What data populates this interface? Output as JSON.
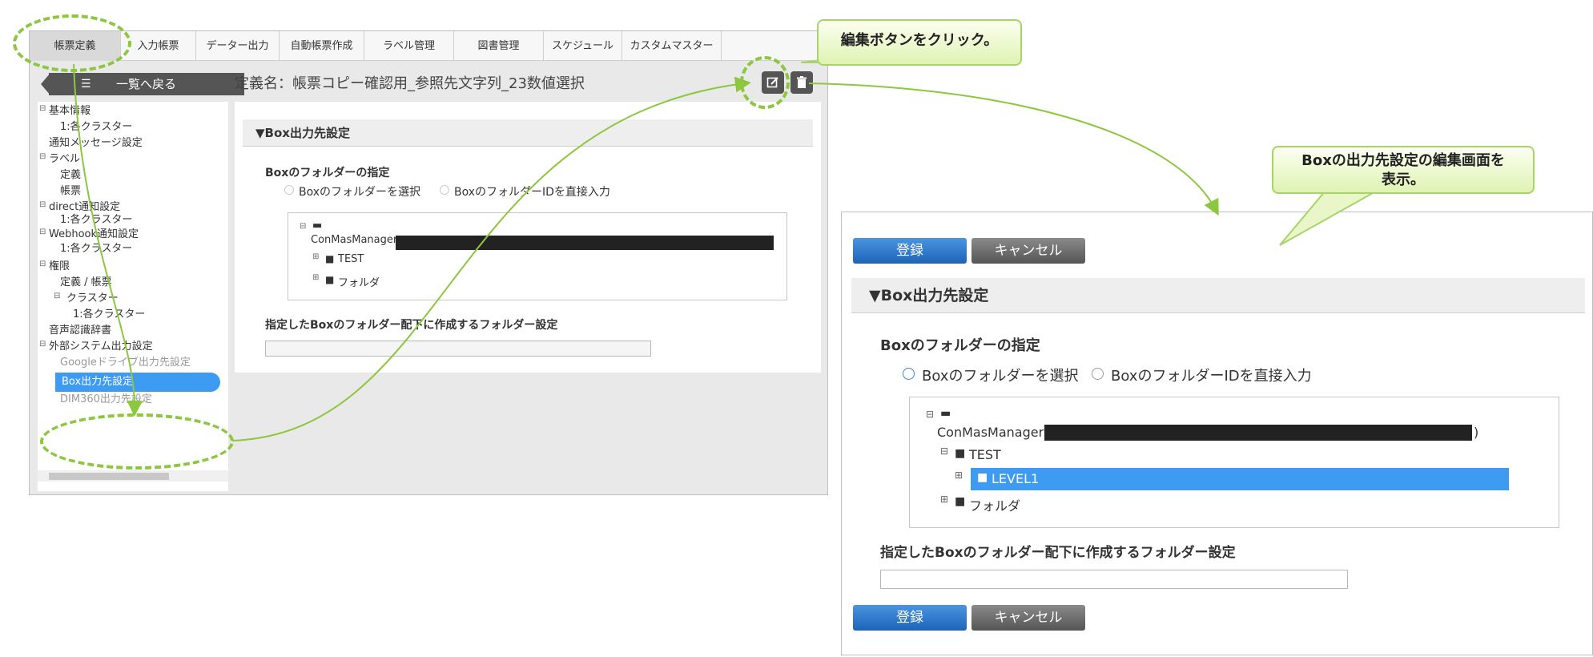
{
  "left_screen": {
    "tabs": [
      "帳票定義",
      "入力帳票",
      "データー出力",
      "自動帳票作成",
      "ラベル管理",
      "図書管理",
      "スケジュール",
      "カスタムマスター"
    ],
    "back_button": "一覧へ戻る",
    "definition_title": "定義名：帳票コピー確認用_参照先文字列_23数値選択",
    "tree": {
      "basic_info": "基本情報",
      "basic_cluster": "1:各クラスター",
      "notification_msg": "通知メッセージ設定",
      "label": "ラベル",
      "label_definition": "定義",
      "label_form": "帳票",
      "direct_notify": "direct通知設定",
      "direct_cluster": "1:各クラスター",
      "webhook_notify": "Webhook通知設定",
      "webhook_cluster": "1:各クラスター",
      "permission": "権限",
      "perm_def_form": "定義 / 帳票",
      "perm_cluster": "クラスター",
      "perm_cluster_item": "1:各クラスター",
      "voice_dict": "音声認識辞書",
      "external_output": "外部システム出力設定",
      "google_drive": "Googleドライブ出力先設定",
      "box_output": "Box出力先設定",
      "dim360": "DIM360出力先設定"
    },
    "section_title": "▼Box出力先設定",
    "folder_spec_label": "Boxのフォルダーの指定",
    "radio_select_folder": "Boxのフォルダーを選択",
    "radio_direct_id": "BoxのフォルダーIDを直接入力",
    "folder_root": "ConMasManager",
    "folders": [
      "TEST",
      "フォルダ"
    ],
    "subfolder_label": "指定したBoxのフォルダー配下に作成するフォルダー設定"
  },
  "right_screen": {
    "register_button": "登録",
    "cancel_button": "キャンセル",
    "section_title": "▼Box出力先設定",
    "folder_spec_label": "Boxのフォルダーの指定",
    "radio_select_folder": "Boxのフォルダーを選択",
    "radio_direct_id": "BoxのフォルダーIDを直接入力",
    "folder_root": "ConMasManager",
    "folder_root_suffix": ")",
    "folder_test": "TEST",
    "folder_level1": "LEVEL1",
    "folder_other": "フォルダ",
    "subfolder_label": "指定したBoxのフォルダー配下に作成するフォルダー設定",
    "register_button_bottom": "登録",
    "cancel_button_bottom": "キャンセル"
  },
  "callouts": {
    "edit_click": "編集ボタンをクリック。",
    "show_edit_line1": "Boxの出力先設定の編集画面を",
    "show_edit_line2": "表示。"
  },
  "colors": {
    "accent_green": "#8dc63f",
    "selection_blue": "#3e9bf2",
    "button_blue": "#1d64b8",
    "button_gray": "#555555"
  }
}
